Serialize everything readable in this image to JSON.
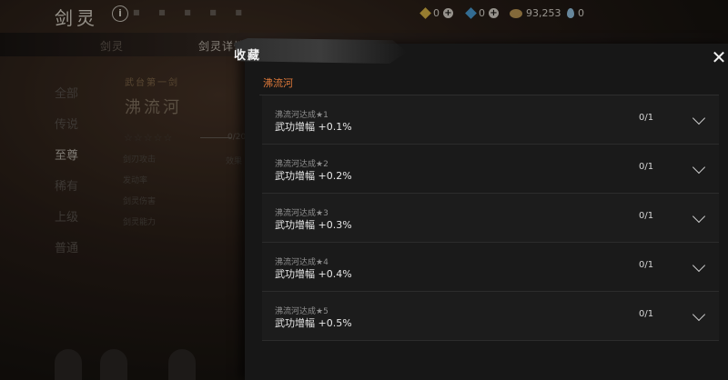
{
  "header": {
    "game_title": "剑灵",
    "info_icon": "i",
    "title_dots": "■ ■ ■ ■ ■",
    "currencies": [
      {
        "icon": "yellow-gem-icon",
        "value": "0",
        "color": "#e7c14a"
      },
      {
        "icon": "blue-gem-icon",
        "value": "0",
        "color": "#4fa6e0"
      },
      {
        "icon": "coin-icon",
        "value": "93,253",
        "color": "#c9a15a"
      },
      {
        "icon": "drop-icon",
        "value": "0",
        "color": "#9fd0f0"
      }
    ],
    "add_symbol": "+"
  },
  "background": {
    "tabs": [
      {
        "label": "剑灵",
        "active": false
      },
      {
        "label": "剑灵详情",
        "active": true
      }
    ],
    "nav": [
      "全部",
      "传说",
      "至尊",
      "稀有",
      "上级",
      "普通"
    ],
    "nav_active": "至尊",
    "sword_subtitle": "武台第一剑",
    "sword_name": "沸流河",
    "stars": "☆☆☆☆☆",
    "progress": "0/20",
    "stats": [
      "剑刃攻击",
      "发动率",
      "剑灵伤害",
      "剑灵能力"
    ],
    "stat_right": "效果"
  },
  "panel": {
    "title": "收藏",
    "close_symbol": "✕",
    "section_label": "沸流河",
    "rows": [
      {
        "condition": "沸流河达成★1",
        "effect": "武功增幅 +0.1%",
        "count": "0/1"
      },
      {
        "condition": "沸流河达成★2",
        "effect": "武功增幅 +0.2%",
        "count": "0/1"
      },
      {
        "condition": "沸流河达成★3",
        "effect": "武功增幅 +0.3%",
        "count": "0/1"
      },
      {
        "condition": "沸流河达成★4",
        "effect": "武功增幅 +0.4%",
        "count": "0/1"
      },
      {
        "condition": "沸流河达成★5",
        "effect": "武功增幅 +0.5%",
        "count": "0/1"
      }
    ],
    "accent_color": "#e07a3a"
  }
}
